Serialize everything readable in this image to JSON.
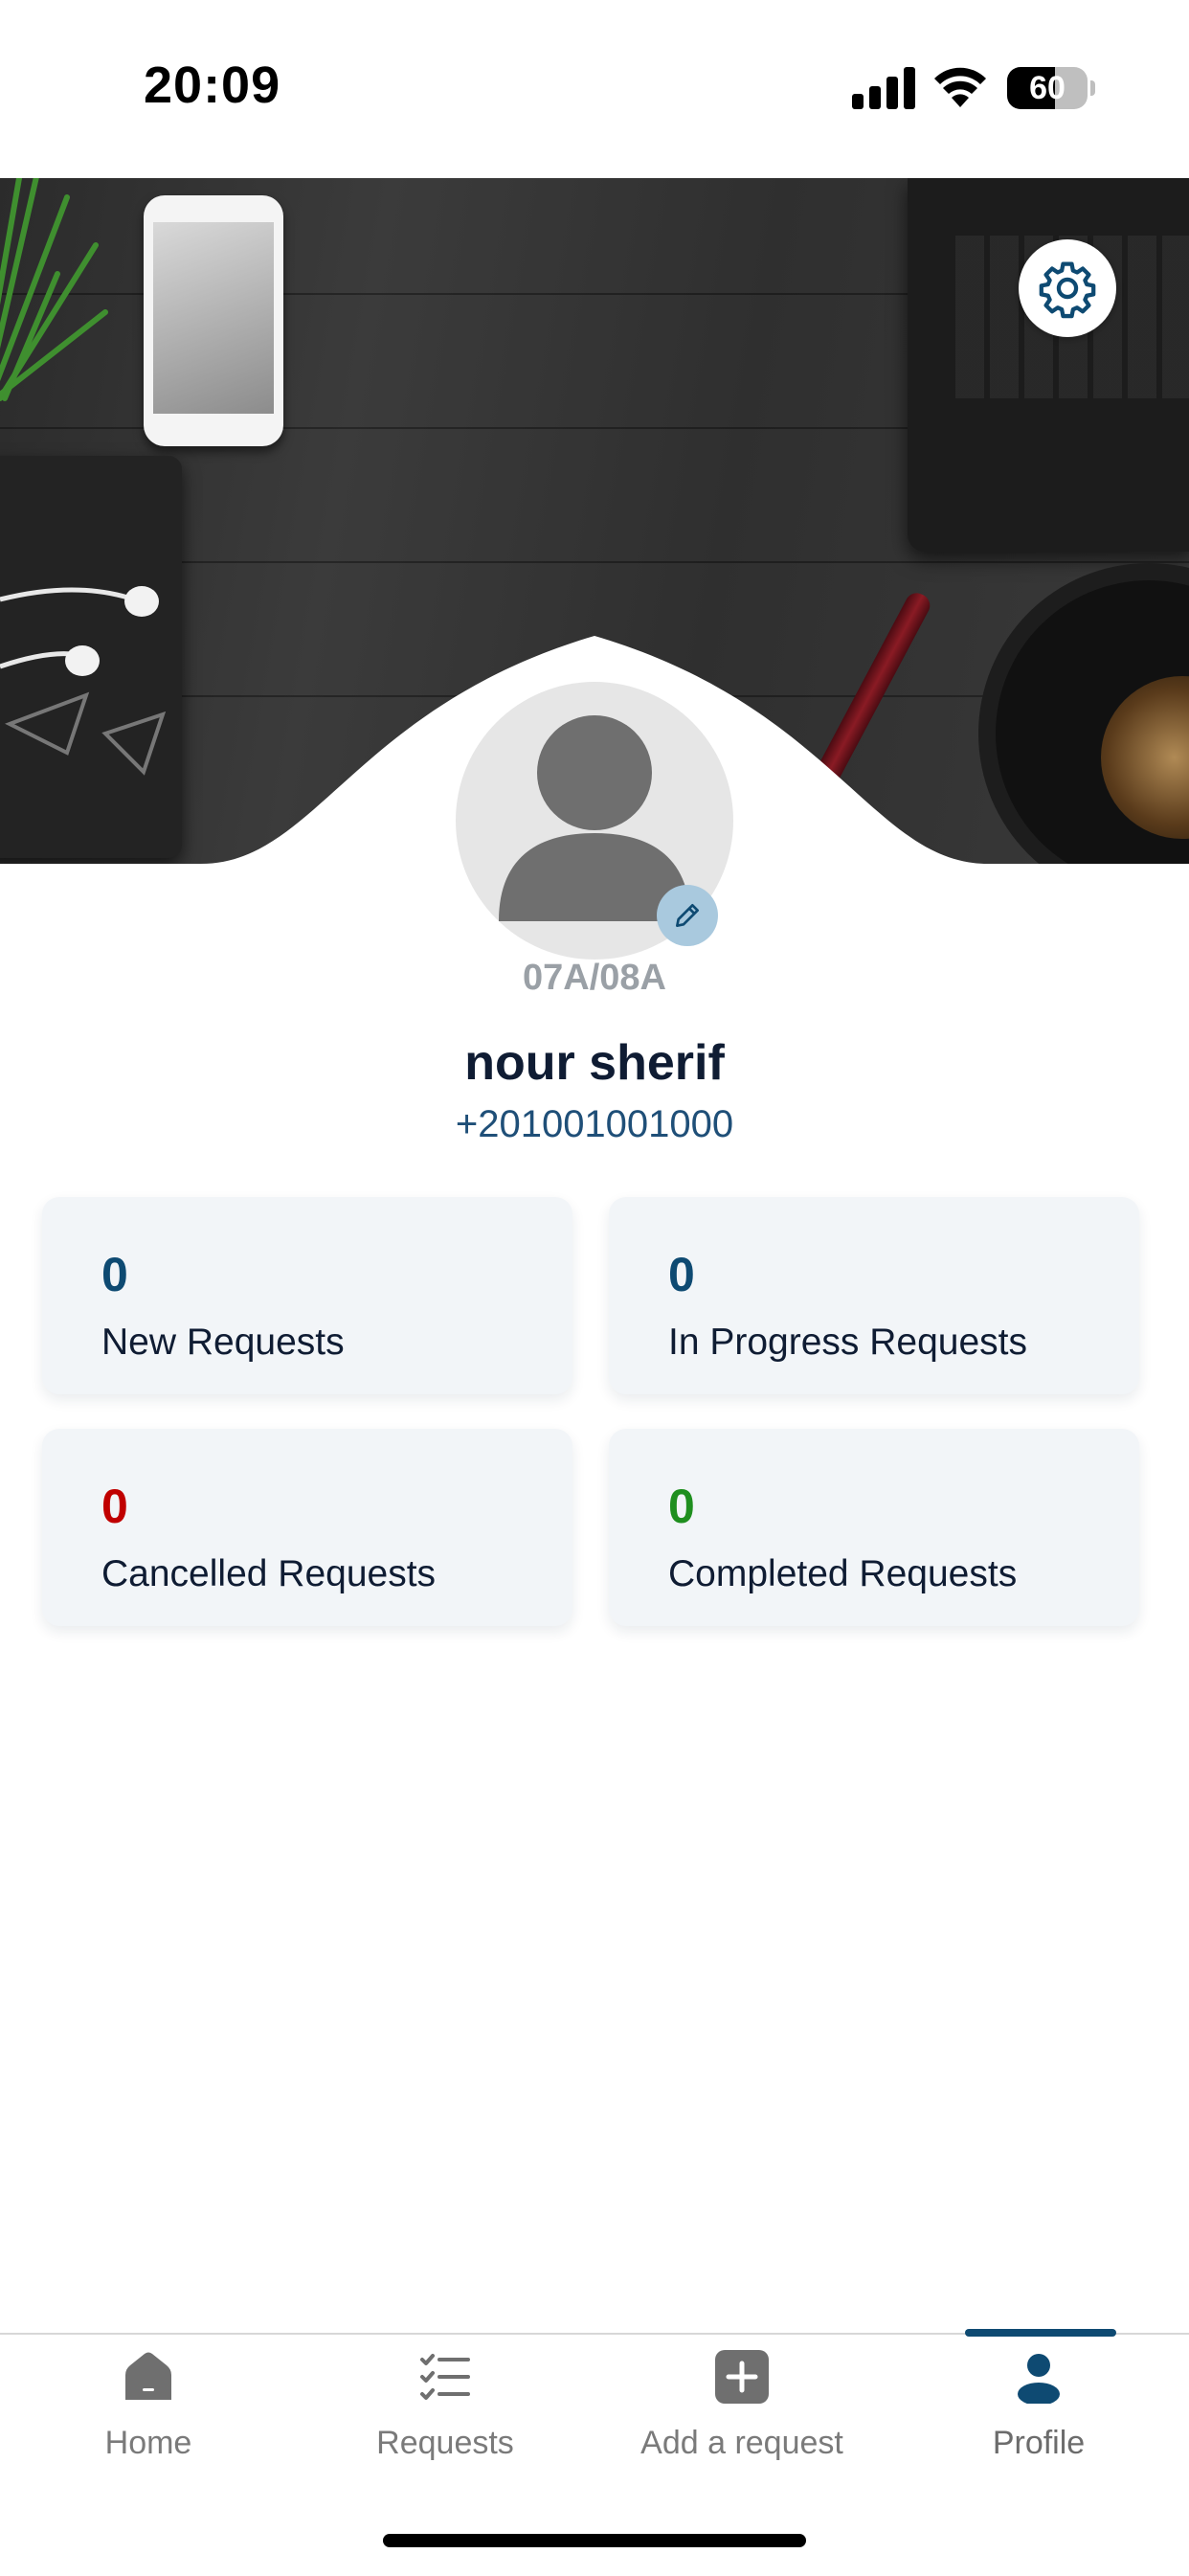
{
  "status_bar": {
    "time": "20:09",
    "battery": "60"
  },
  "header": {
    "settings_icon": "gear-icon"
  },
  "profile": {
    "unit_code": "07A/08A",
    "name": "nour sherif",
    "phone": "+201001001000",
    "avatar_icon": "user-silhouette-icon",
    "edit_icon": "pencil-icon"
  },
  "stats": [
    {
      "value": "0",
      "label": "New Requests",
      "color": "#0e4a72"
    },
    {
      "value": "0",
      "label": "In Progress Requests",
      "color": "#0e4a72"
    },
    {
      "value": "0",
      "label": "Cancelled Requests",
      "color": "#c00000"
    },
    {
      "value": "0",
      "label": "Completed Requests",
      "color": "#1f8f1f"
    }
  ],
  "nav": {
    "active": "Profile",
    "tabs": [
      {
        "label": "Home",
        "icon": "home-icon"
      },
      {
        "label": "Requests",
        "icon": "checklist-icon"
      },
      {
        "label": "Add a request",
        "icon": "plus-square-icon"
      },
      {
        "label": "Profile",
        "icon": "person-icon"
      }
    ]
  },
  "colors": {
    "accent": "#0e4a72",
    "title": "#0f1c33",
    "card_bg": "#f2f5f8"
  }
}
